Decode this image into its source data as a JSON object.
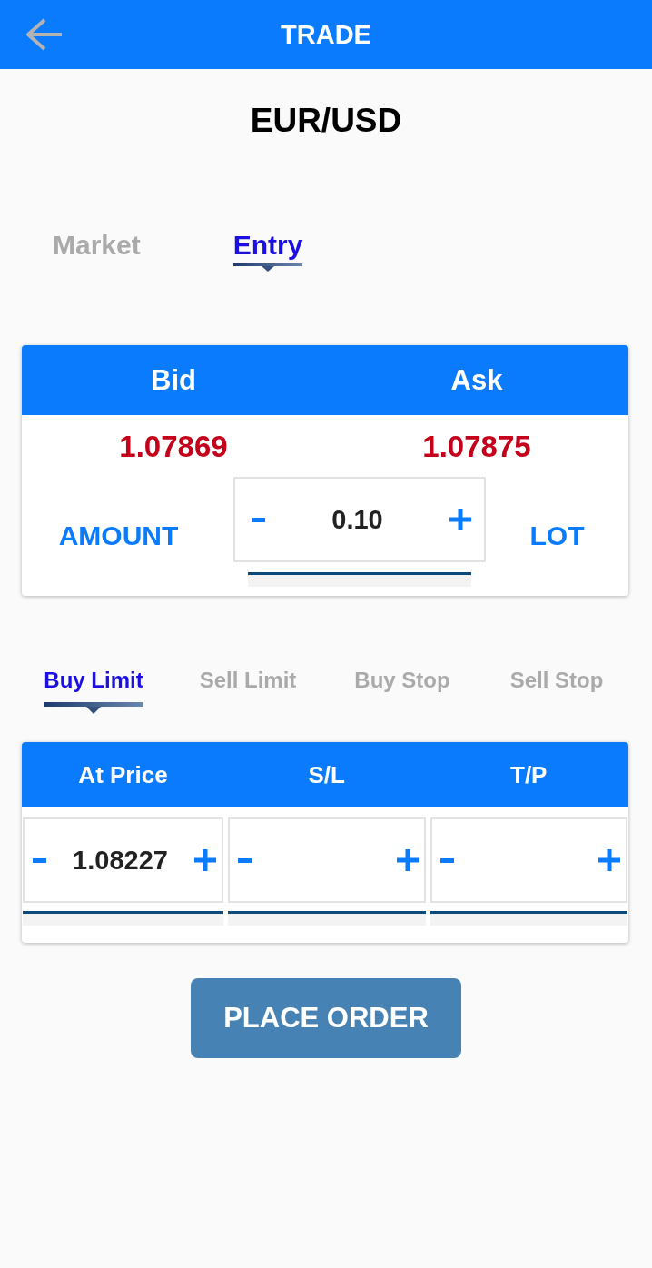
{
  "header": {
    "title": "TRADE"
  },
  "symbol": "EUR/USD",
  "order_tabs": [
    {
      "label": "Market",
      "selected": false
    },
    {
      "label": "Entry",
      "selected": true
    }
  ],
  "quote": {
    "columns": [
      "Bid",
      "Ask"
    ],
    "prices": [
      "1.07869",
      "1.07875"
    ],
    "amount_label": "AMOUNT",
    "amount_value": "0.10",
    "unit": "LOT"
  },
  "entry_tabs": [
    {
      "label": "Buy Limit",
      "selected": true
    },
    {
      "label": "Sell Limit",
      "selected": false
    },
    {
      "label": "Buy Stop",
      "selected": false
    },
    {
      "label": "Sell Stop",
      "selected": false
    }
  ],
  "order_fields": [
    {
      "label": "At Price",
      "value": "1.08227"
    },
    {
      "label": "S/L"
    },
    {
      "label": "T/P"
    }
  ],
  "place_order_button": "PLACE ORDER"
}
